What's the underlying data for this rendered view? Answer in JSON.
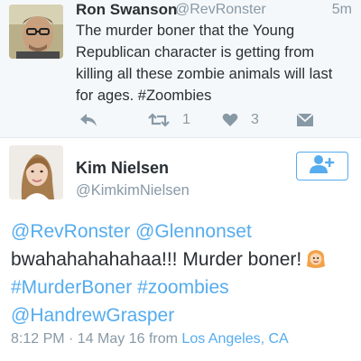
{
  "reply_tweet": {
    "author_name": "Ron Swanson",
    "author_handle": "@RevRonster",
    "timestamp": "5m",
    "text": "The murder boner that the Young Republican character is getting from killing all these zombie animals will last for ages. #Zoombies",
    "actions": {
      "retweet_count": "1",
      "like_count": "3"
    }
  },
  "main_tweet": {
    "author_name": "Kim Nielsen",
    "author_handle": "@KimkimNielsen",
    "text_parts": {
      "mention_1": "@RevRonster",
      "mention_2": "@Glennonset",
      "body": "bwahahahahahaa!!! Murder boner!",
      "hashtag_1": "#MurderBoner",
      "hashtag_2": "#zoombies",
      "mention_3": "@HandrewGrasper"
    },
    "time": "8:12 PM · 14 May 16",
    "from_label": "from",
    "location": "Los Angeles, CA"
  },
  "colors": {
    "accent": "#55acee",
    "muted": "#8899a6",
    "text": "#292f33"
  },
  "icons": [
    "reply-icon",
    "retweet-icon",
    "heart-icon",
    "direct-message-icon",
    "follow-user-icon",
    "face-emoji-icon"
  ]
}
